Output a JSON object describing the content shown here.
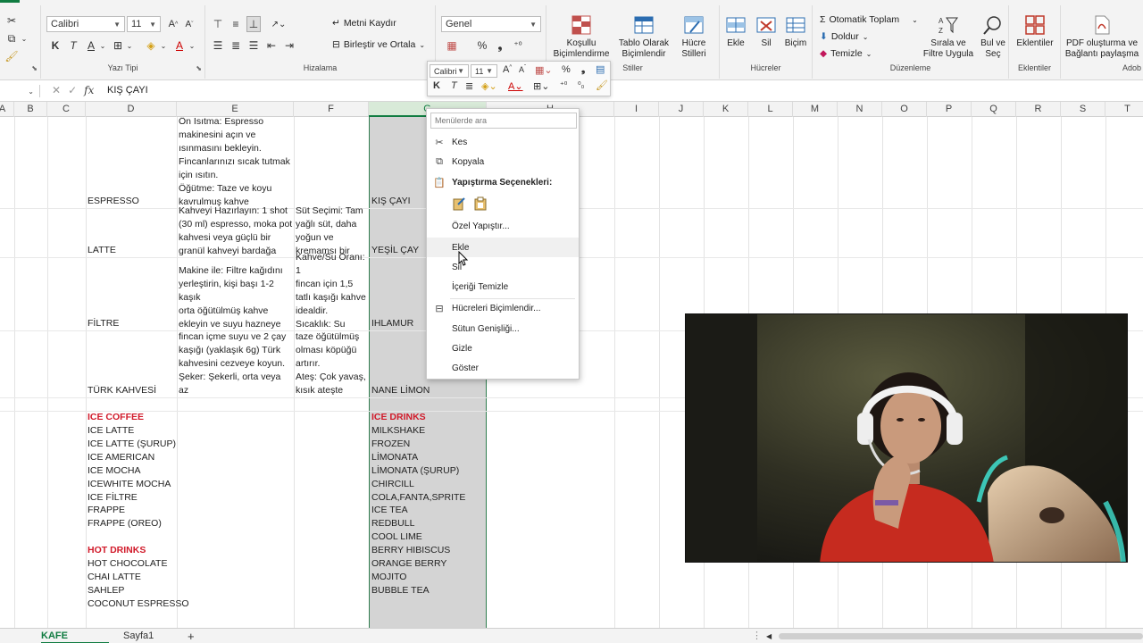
{
  "ribbon": {
    "font": {
      "name": "Calibri",
      "size": "11",
      "group_label": "Yazı Tipi"
    },
    "alignment": {
      "wrap_text": "Metni Kaydır",
      "merge_center": "Birleştir ve Ortala",
      "group_label": "Hizalama"
    },
    "number": {
      "format": "Genel",
      "percent": "%"
    },
    "styles": {
      "conditional": "Koşullu Biçimlendirme",
      "table": "Tablo Olarak Biçimlendir",
      "cell_styles": "Hücre Stilleri",
      "group_label": "Stiller"
    },
    "cells": {
      "insert": "Ekle",
      "delete": "Sil",
      "format": "Biçim",
      "group_label": "Hücreler"
    },
    "editing": {
      "autosum": "Otomatik Toplam",
      "fill": "Doldur",
      "clear": "Temizle",
      "sort_filter": "Sırala ve Filtre Uygula",
      "find_select": "Bul ve Seç",
      "group_label": "Düzenleme"
    },
    "addins": {
      "label": "Eklentiler",
      "group_label": "Eklentiler"
    },
    "pdf": {
      "label": "PDF oluşturma ve Bağlantı paylaşma",
      "group_label": "Adob"
    }
  },
  "formula_bar": {
    "fx": "fx",
    "content": "KIŞ ÇAYI"
  },
  "columns": [
    "A",
    "B",
    "C",
    "D",
    "E",
    "F",
    "G",
    "H",
    "I",
    "J",
    "K",
    "L",
    "M",
    "N",
    "O",
    "P",
    "Q",
    "R",
    "S",
    "T"
  ],
  "cells": {
    "espresso": "ESPRESSO",
    "latte": "LATTE",
    "filtre": "FİLTRE",
    "turk_kahvesi": "TÜRK KAHVESİ",
    "ice_coffee_header": "ICE COFFEE",
    "ice_coffee_items": [
      "ICE LATTE",
      "ICE LATTE (ŞURUP)",
      "ICE AMERICAN",
      "ICE MOCHA",
      "ICEWHITE MOCHA",
      "ICE FİLTRE",
      "FRAPPE",
      "FRAPPE (OREO)"
    ],
    "hot_drinks_header": "HOT DRINKS",
    "hot_drinks_items": [
      "HOT CHOCOLATE",
      "CHAI LATTE",
      "SAHLEP",
      "COCONUT ESPRESSO"
    ],
    "g_kis_cayi": "KIŞ ÇAYI",
    "g_yesil_cay": "YEŞİL ÇAY",
    "g_ihlamur": "IHLAMUR",
    "g_nane_limon": "NANE LİMON",
    "ice_drinks_header": "ICE DRINKS",
    "ice_drinks_items": [
      "MILKSHAKE",
      "FROZEN",
      "LİMONATA",
      "LİMONATA (ŞURUP)",
      "CHIRCILL",
      "COLA,FANTA,SPRITE",
      "ICE TEA",
      "REDBULL",
      "COOL LIME",
      "BERRY HIBISCUS",
      "ORANGE BERRY",
      "MOJITO",
      "BUBBLE TEA"
    ],
    "e_espresso": "Ön Isıtma: Espresso\nmakinesini açın ve\nısınmasını bekleyin.\nFincanlarınızı sıcak tutmak\niçin ısıtın.\nÖğütme: Taze ve koyu\nkavrulmuş kahve",
    "e_latte": "Kahveyi Hazırlayın: 1 shot\n(30 ml) espresso, moka pot\nkahvesi veya güçlü bir\ngranül kahveyi bardağa alın.",
    "f_latte": "Süt Seçimi: Tam\nyağlı süt, daha\nyoğun ve\nkremamsı bir",
    "e_filtre": "Makine ile: Filtre kağıdını\nyerleştirin, kişi başı 1-2 kaşık\norta öğütülmüş kahve\nekleyin ve suyu hazneye\ndoldurarak çalıştırın.",
    "f_filtre": "Kahve/Su Oranı: 1\nfincan için 1,5\ntatlı kaşığı kahve\nidealdir.\nSıcaklık: Su\nkaynar olmamalı,",
    "e_turk": "fincan içme suyu ve 2 çay\nkaşığı (yaklaşık 6g) Türk\nkahvesini cezveye koyun.\nŞeker: Şekerli, orta veya az\nşekerli isteğinize göre şekeri",
    "f_turk": "taze öğütülmüş\nolması köpüğü\nartırır.\nAteş: Çok yavaş,\nkısık ateşte"
  },
  "mini_toolbar": {
    "font": "Calibri",
    "size": "11",
    "percent": "%",
    "bold": "K",
    "italic": "T"
  },
  "context_menu": {
    "search_placeholder": "Menülerde ara",
    "cut": "Kes",
    "copy": "Kopyala",
    "paste_options": "Yapıştırma Seçenekleri:",
    "paste_special": "Özel Yapıştır...",
    "insert": "Ekle",
    "delete": "Sil",
    "clear_contents": "İçeriği Temizle",
    "format_cells": "Hücreleri Biçimlendir...",
    "column_width": "Sütun Genişliği...",
    "hide": "Gizle",
    "unhide": "Göster"
  },
  "sheets": {
    "active": "KAFE MENÜSÜ",
    "other": "Sayfa1",
    "add": "+"
  },
  "colors": {
    "accent": "#107c41",
    "header_red": "#d11a2a",
    "selection": "#d4d4d4"
  }
}
